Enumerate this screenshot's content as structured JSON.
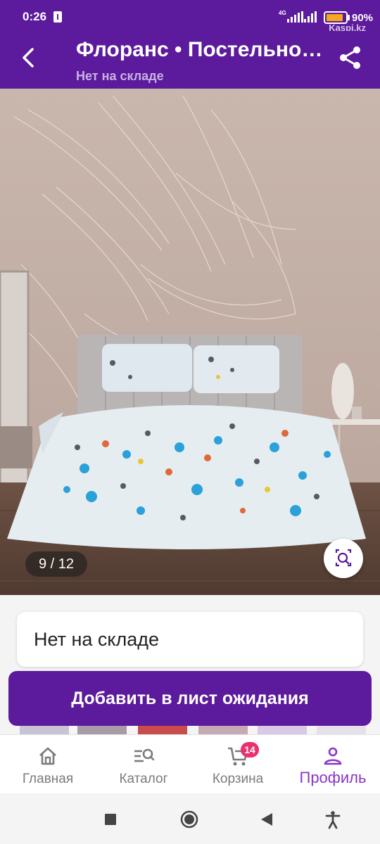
{
  "status_bar": {
    "time": "0:26",
    "network_label": "4G",
    "battery_percent": 90,
    "battery_text": "90%",
    "watermark": "Kaspi.kz"
  },
  "app_bar": {
    "title": "Флоранс • Постельное белье",
    "subtitle": "Нет на складе"
  },
  "gallery": {
    "counter": "9 / 12"
  },
  "stock_card": {
    "text": "Нет на складе"
  },
  "waitlist_button": {
    "label": "Добавить в лист ожидания"
  },
  "bottom_nav": {
    "items": [
      {
        "label": "Главная",
        "icon": "home-icon",
        "active": false
      },
      {
        "label": "Каталог",
        "icon": "catalog-search-icon",
        "active": false
      },
      {
        "label": "Корзина",
        "icon": "cart-icon",
        "active": false,
        "badge": "14"
      },
      {
        "label": "Профиль",
        "icon": "person-icon",
        "active": true
      }
    ]
  },
  "system_nav": {
    "icons": [
      "recents-square-icon",
      "home-circle-icon",
      "back-triangle-icon",
      "accessibility-icon"
    ]
  },
  "colors": {
    "brand": "#5c1a9c",
    "active_nav": "#8a35c8",
    "badge": "#e8316e",
    "battery": "#f5a623"
  }
}
